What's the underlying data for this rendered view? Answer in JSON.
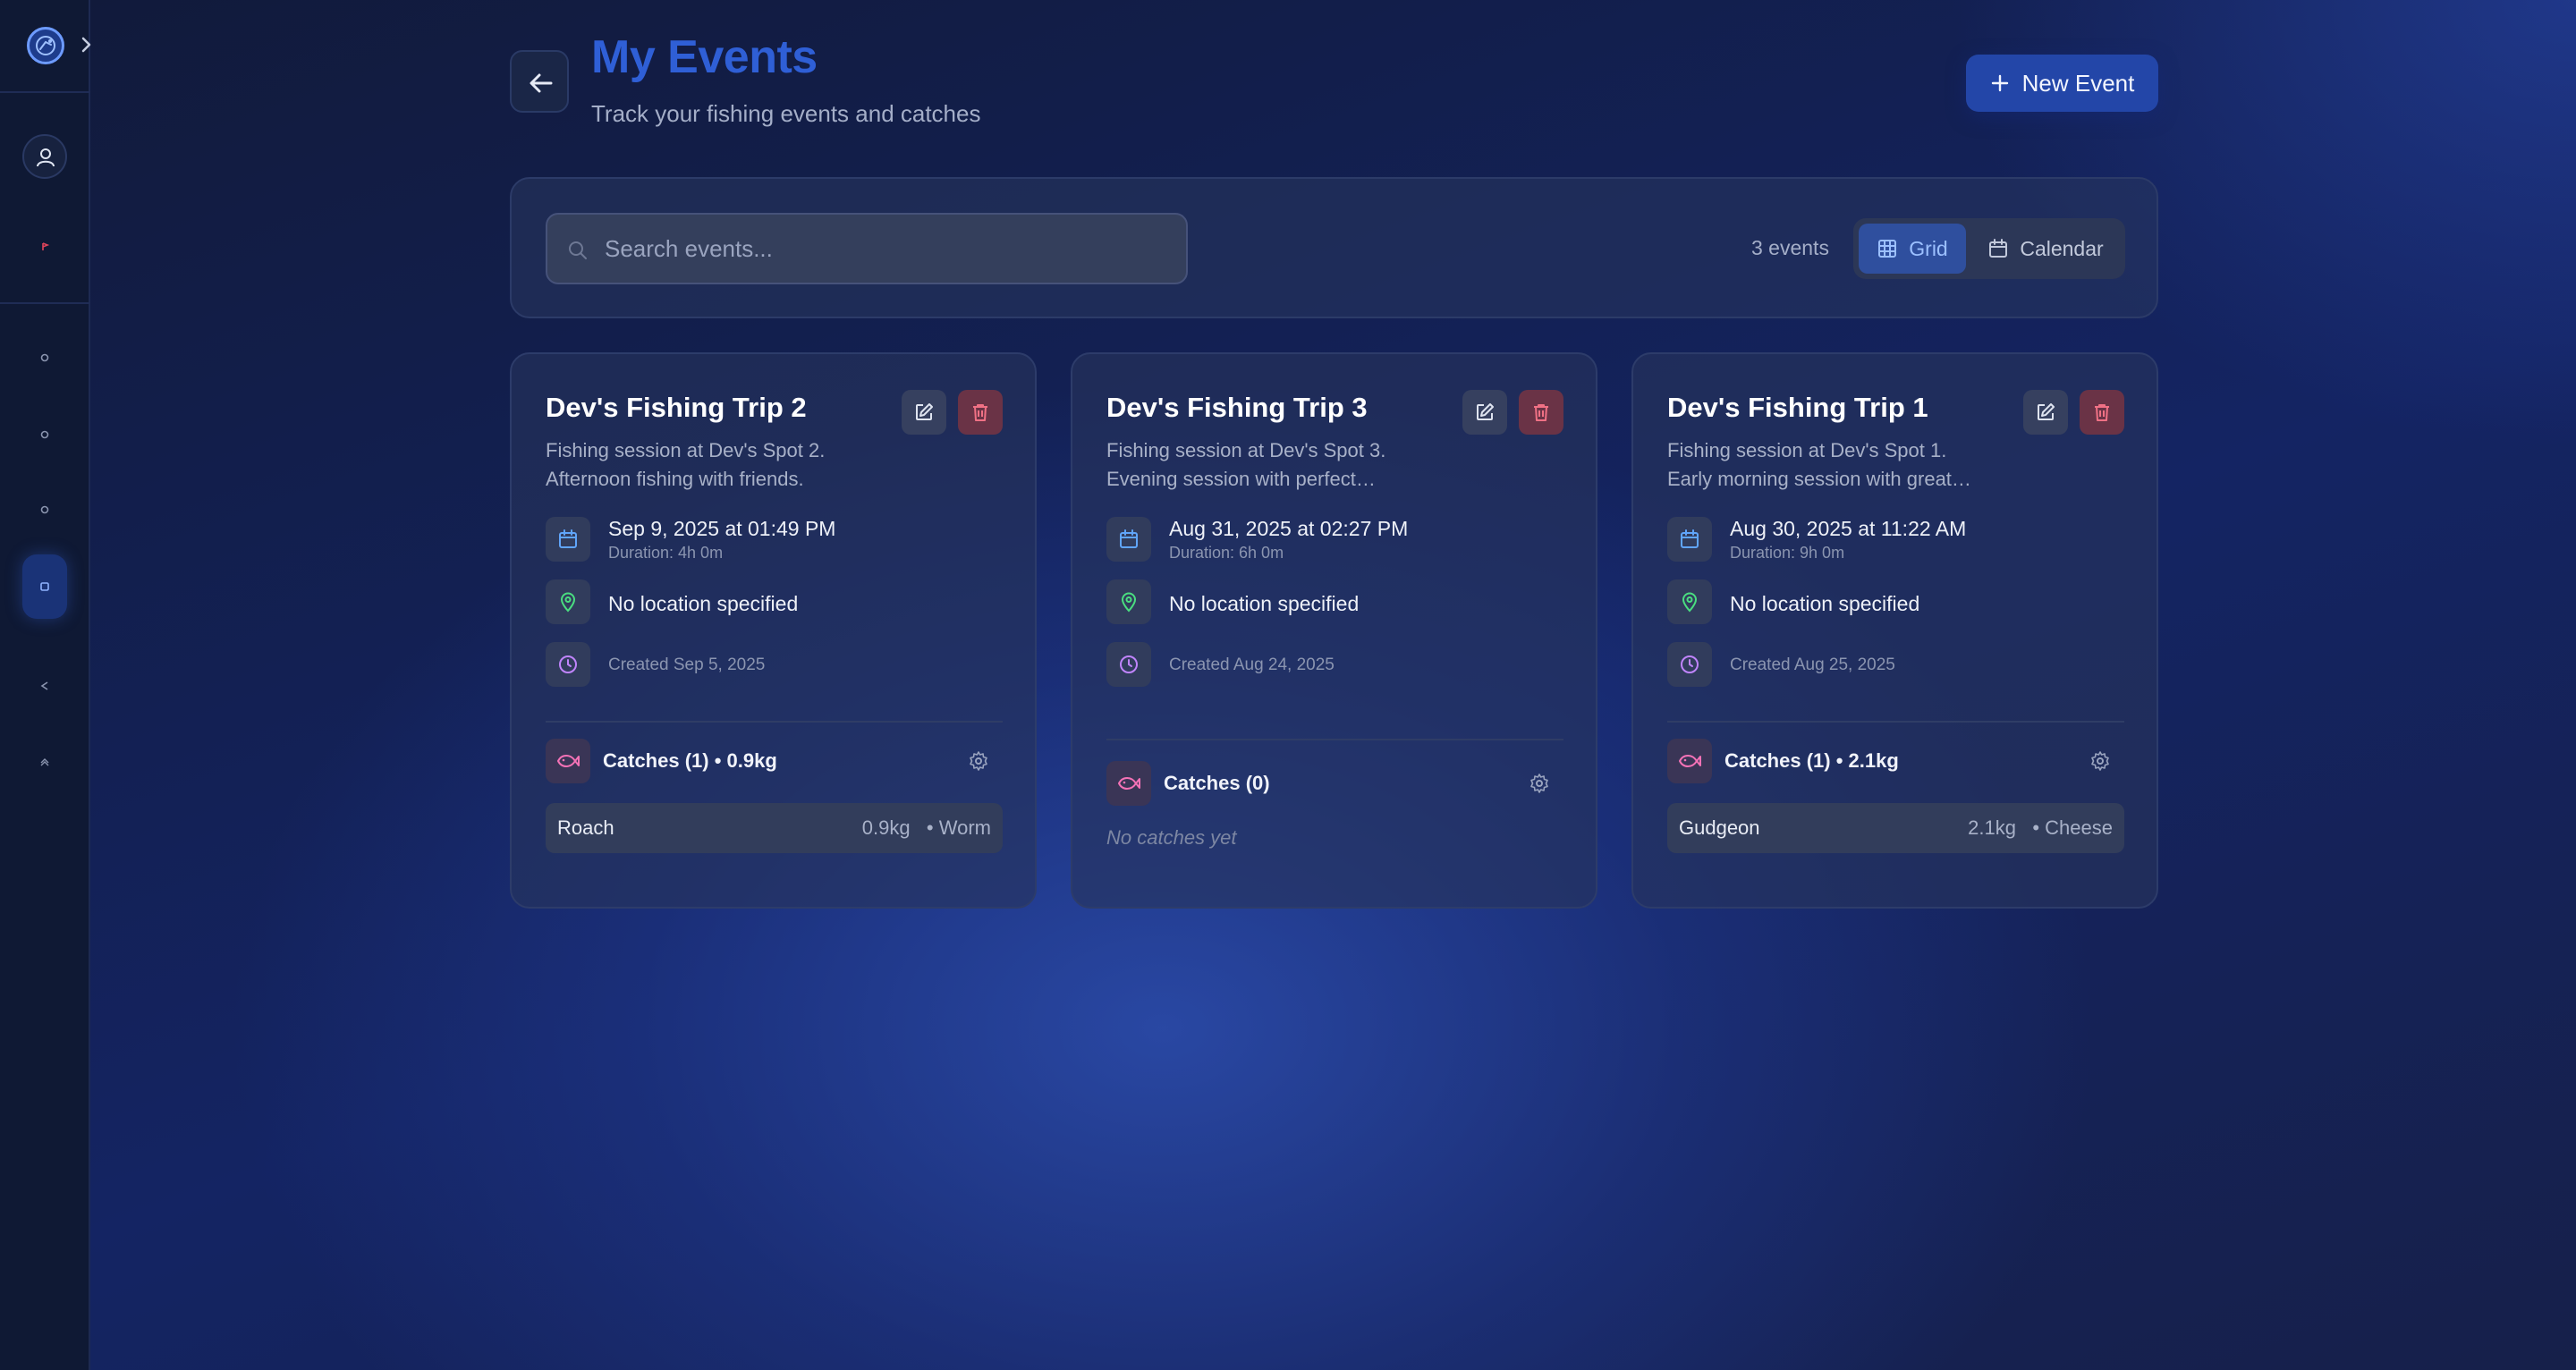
{
  "header": {
    "title": "My Events",
    "subtitle": "Track your fishing events and catches",
    "new_event_label": "New Event"
  },
  "search": {
    "placeholder": "Search events..."
  },
  "toolbar": {
    "event_count": "3 events",
    "view_grid_label": "Grid",
    "view_calendar_label": "Calendar",
    "active_view": "Grid"
  },
  "colors": {
    "accent": "#2f5fd6",
    "primary_button": "#2346a8",
    "delete": "#f07185",
    "location": "#4ade80",
    "calendar_icon": "#60a5fa",
    "clock_icon": "#c084fc",
    "fish_icon": "#f472b6"
  },
  "events": [
    {
      "title": "Dev's Fishing Trip 2",
      "description": "Fishing session at Dev's Spot 2. Afternoon fishing with friends.",
      "date": "Sep 9, 2025 at 01:49 PM",
      "duration": "Duration: 4h 0m",
      "location": "No location specified",
      "created": "Created Sep 5, 2025",
      "catches_label": "Catches (1) • 0.9kg",
      "catches": [
        {
          "species": "Roach",
          "weight": "0.9kg",
          "bait": "• Worm"
        }
      ]
    },
    {
      "title": "Dev's Fishing Trip 3",
      "description": "Fishing session at Dev's Spot 3. Evening session with perfect…",
      "date": "Aug 31, 2025 at 02:27 PM",
      "duration": "Duration: 6h 0m",
      "location": "No location specified",
      "created": "Created Aug 24, 2025",
      "catches_label": "Catches (0)",
      "no_catches": "No catches yet",
      "catches": []
    },
    {
      "title": "Dev's Fishing Trip 1",
      "description": "Fishing session at Dev's Spot 1. Early morning session with great…",
      "date": "Aug 30, 2025 at 11:22 AM",
      "duration": "Duration: 9h 0m",
      "location": "No location specified",
      "created": "Created Aug 25, 2025",
      "catches_label": "Catches (1) • 2.1kg",
      "catches": [
        {
          "species": "Gudgeon",
          "weight": "2.1kg",
          "bait": "• Cheese"
        }
      ]
    }
  ],
  "sidebar": {
    "icons": [
      "app-logo-icon",
      "chevron-right-icon",
      "user-icon",
      "flag-icon",
      "nav-dot-icon",
      "calendar-icon"
    ]
  }
}
